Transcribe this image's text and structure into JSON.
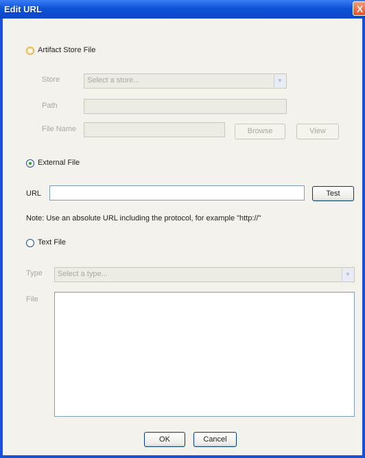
{
  "window": {
    "title": "Edit URL",
    "close_glyph": "X"
  },
  "artifact": {
    "radio_label": "Artifact Store File",
    "store_label": "Store",
    "store_placeholder": "Select a store...",
    "path_label": "Path",
    "path_value": "",
    "file_name_label": "File Name",
    "file_name_value": "",
    "browse_label": "Browse",
    "view_label": "View"
  },
  "external": {
    "radio_label": "External File",
    "url_label": "URL",
    "url_value": "",
    "test_label": "Test",
    "note": "Note: Use an absolute URL including the protocol, for example \"http://\""
  },
  "textfile": {
    "radio_label": "Text File",
    "type_label": "Type",
    "type_placeholder": "Select a type...",
    "file_label": "File",
    "file_value": ""
  },
  "footer": {
    "ok_label": "OK",
    "cancel_label": "Cancel"
  },
  "selected_option": "External File"
}
